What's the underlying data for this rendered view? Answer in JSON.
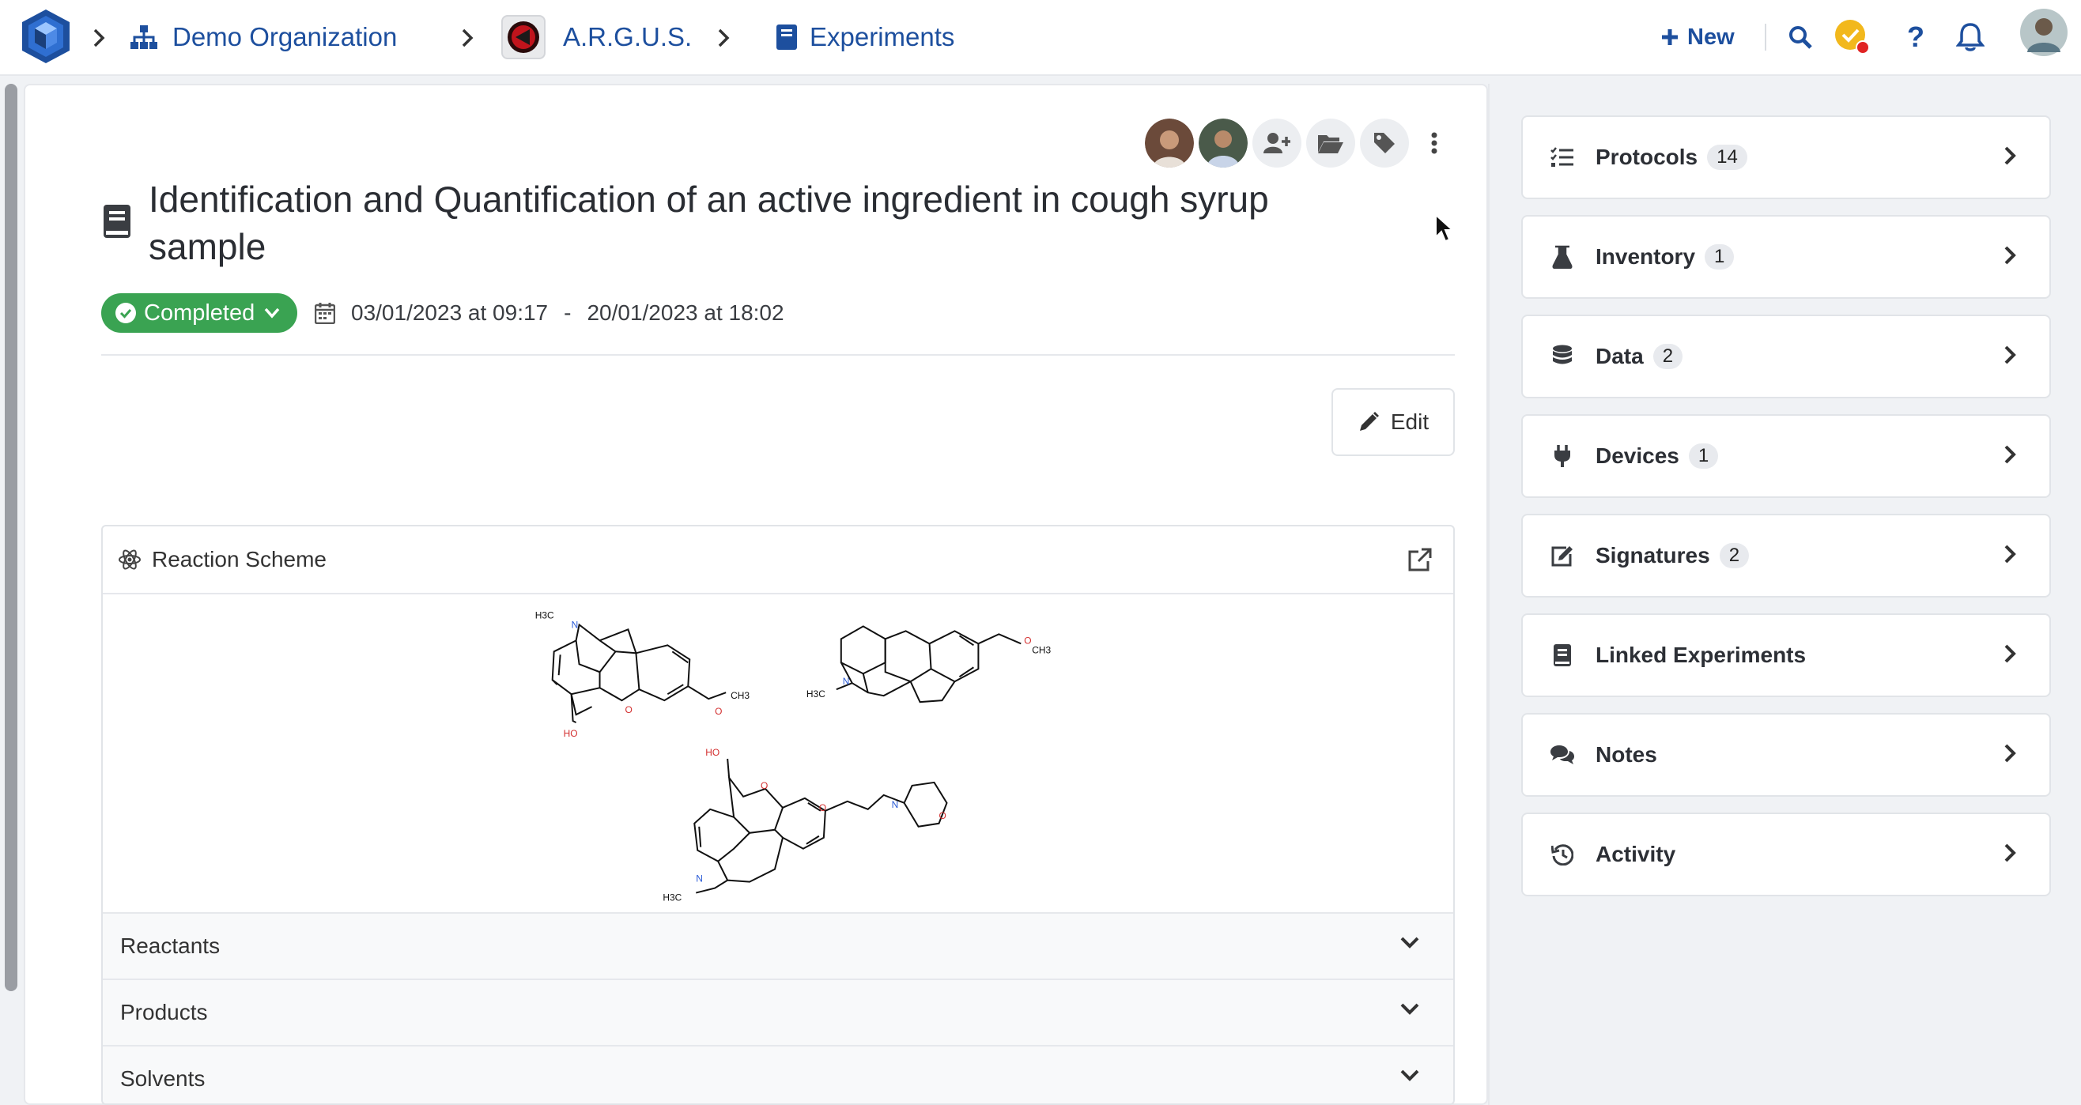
{
  "breadcrumbs": {
    "organization": "Demo Organization",
    "project": "A.R.G.U.S.",
    "section": "Experiments"
  },
  "header": {
    "new_label": "New"
  },
  "experiment": {
    "title": "Identification and Quantification of an active ingredient in cough syrup sample",
    "status": "Completed",
    "start": "03/01/2023 at 09:17",
    "separator": "-",
    "end": "20/01/2023 at 18:02",
    "edit_label": "Edit"
  },
  "reaction_scheme": {
    "title": "Reaction Scheme",
    "molecule_labels": {
      "m1_methyl": "H3C",
      "m1_ome": "CH3",
      "m1_oh": "HO",
      "m1_n": "N",
      "m1_o": "O",
      "m1_o2": "O",
      "m2_methyl": "H3C",
      "m2_ome": "CH3",
      "m2_n": "N",
      "m2_o": "O",
      "m3_oh": "HO",
      "m3_methyl": "H3C",
      "m3_n": "N",
      "m3_n2": "N",
      "m3_o": "O",
      "m3_o2": "O",
      "m3_o3": "O"
    }
  },
  "accordion": [
    {
      "label": "Reactants"
    },
    {
      "label": "Products"
    },
    {
      "label": "Solvents"
    }
  ],
  "sidebar": {
    "items": [
      {
        "label": "Protocols",
        "count": "14",
        "icon": "list-check-icon"
      },
      {
        "label": "Inventory",
        "count": "1",
        "icon": "flask-icon"
      },
      {
        "label": "Data",
        "count": "2",
        "icon": "database-icon"
      },
      {
        "label": "Devices",
        "count": "1",
        "icon": "plug-icon"
      },
      {
        "label": "Signatures",
        "count": "2",
        "icon": "signature-icon"
      },
      {
        "label": "Linked Experiments",
        "count": "",
        "icon": "book-icon"
      },
      {
        "label": "Notes",
        "count": "",
        "icon": "comments-icon"
      },
      {
        "label": "Activity",
        "count": "",
        "icon": "history-icon"
      }
    ]
  },
  "colors": {
    "brand": "#1d4f9e",
    "status_completed": "#3aa352",
    "notification_dot": "#e02424",
    "task_badge": "#f2b81c"
  }
}
